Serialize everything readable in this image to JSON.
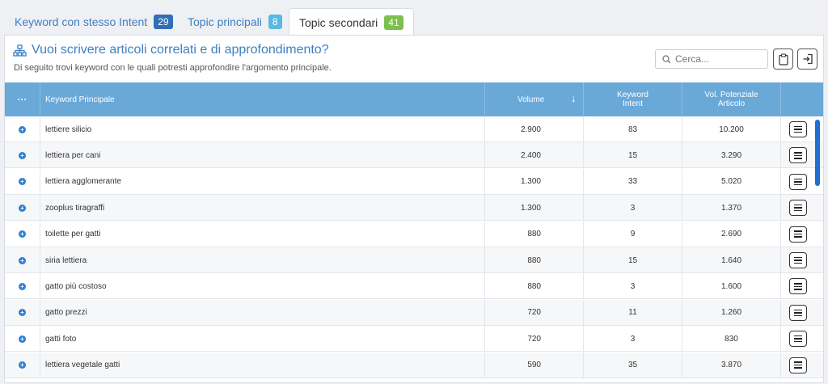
{
  "tabs": [
    {
      "label": "Keyword con stesso Intent",
      "count": "29",
      "color": "#2f6fb6"
    },
    {
      "label": "Topic principali",
      "count": "8",
      "color": "#5bb8e0"
    },
    {
      "label": "Topic secondari",
      "count": "41",
      "color": "#7bbf4e"
    }
  ],
  "header": {
    "title": "Vuoi scrivere articoli correlati e di approfondimento?",
    "subtitle": "Di seguito trovi keyword con le quali potresti approfondire l'argomento principale.",
    "search_placeholder": "Cerca..."
  },
  "table": {
    "columns": {
      "menu": "···",
      "keyword": "Keyword Principale",
      "volume": "Volume",
      "sort_arrow": "↓",
      "intent_1": "Keyword",
      "intent_2": "Intent",
      "potential_1": "Vol. Potenziale",
      "potential_2": "Articolo"
    },
    "rows": [
      {
        "keyword": "lettiere silicio",
        "volume": "2.900",
        "intent": "83",
        "potential": "10.200"
      },
      {
        "keyword": "lettiera per cani",
        "volume": "2.400",
        "intent": "15",
        "potential": "3.290"
      },
      {
        "keyword": "lettiera agglomerante",
        "volume": "1.300",
        "intent": "33",
        "potential": "5.020"
      },
      {
        "keyword": "zooplus tiragraffi",
        "volume": "1.300",
        "intent": "3",
        "potential": "1.370"
      },
      {
        "keyword": "toilette per gatti",
        "volume": "880",
        "intent": "9",
        "potential": "2.690"
      },
      {
        "keyword": "siria lettiera",
        "volume": "880",
        "intent": "15",
        "potential": "1.640"
      },
      {
        "keyword": "gatto più costoso",
        "volume": "880",
        "intent": "3",
        "potential": "1.600"
      },
      {
        "keyword": "gatto prezzi",
        "volume": "720",
        "intent": "11",
        "potential": "1.260"
      },
      {
        "keyword": "gatti foto",
        "volume": "720",
        "intent": "3",
        "potential": "830"
      },
      {
        "keyword": "lettiera vegetale gatti",
        "volume": "590",
        "intent": "35",
        "potential": "3.870"
      }
    ]
  }
}
